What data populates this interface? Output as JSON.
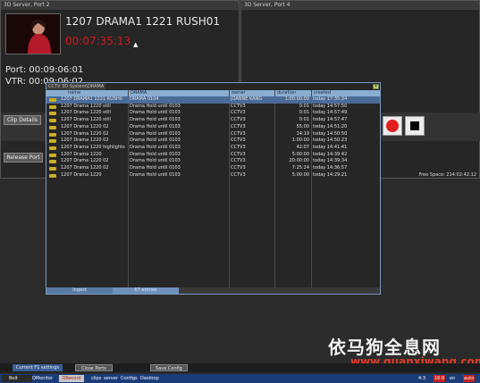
{
  "port_left": {
    "title": "3D Server, Port 2",
    "clip_name": "1207 DRAMA1 1221 RUSH01",
    "timecode": "00:07:35:13",
    "port_line": "Port: 00:09:06:01",
    "vtr_line": "VTR: 00:09:06:02",
    "buttons": {
      "clip_details": "Clip Details",
      "release_port": "Release Port"
    }
  },
  "port_right": {
    "title": "3D Server, Port 4",
    "free_space": "Free Space: 214:02:42:12"
  },
  "browser": {
    "title": "CCTV 3D System\\DRAMA",
    "columns": [
      "name",
      "DRAMA",
      "owner",
      "duration",
      "created"
    ],
    "rows": [
      {
        "name": "1207 DRAMA1 1221 RUSH0",
        "group": "DRAMA 0104",
        "owner": "JOANNE KANG",
        "duration": "1:00:00:00",
        "created": "today 17:35:34",
        "selected": true
      },
      {
        "name": "1207 Drama 1220 still",
        "group": "Drama Hold until 0103",
        "owner": "CCTV3",
        "duration": "0:01",
        "created": "today 14:57:50"
      },
      {
        "name": "1207 Drama 1220 still",
        "group": "Drama Hold until 0103",
        "owner": "CCTV3",
        "duration": "0:01",
        "created": "today 14:57:49"
      },
      {
        "name": "1207 Drama 1220 still",
        "group": "Drama Hold until 0103",
        "owner": "CCTV3",
        "duration": "0:01",
        "created": "today 14:57:47"
      },
      {
        "name": "1207 Drama 1220 02",
        "group": "Drama Hold until 0103",
        "owner": "CCTV3",
        "duration": "55:00",
        "created": "today 14:51:20"
      },
      {
        "name": "1207 Drama 1220 02",
        "group": "Drama Hold until 0103",
        "owner": "CCTV3",
        "duration": "14:19",
        "created": "today 14:50:50"
      },
      {
        "name": "1207 Drama 1220 02",
        "group": "Drama Hold until 0103",
        "owner": "CCTV3",
        "duration": "1:00:00",
        "created": "today 14:50:23"
      },
      {
        "name": "1207 Drama 1220 highlights",
        "group": "Drama Hold until 0103",
        "owner": "CCTV3",
        "duration": "42:07",
        "created": "today 14:41:41"
      },
      {
        "name": "1207 Drama 1220",
        "group": "Drama Hold until 0103",
        "owner": "CCTV3",
        "duration": "5:00:00",
        "created": "today 14:39:42"
      },
      {
        "name": "1207 Drama 1220 02",
        "group": "Drama Hold until 0103",
        "owner": "CCTV3",
        "duration": "20:00:00",
        "created": "today 14:39:34"
      },
      {
        "name": "1207 Drama 1220 02",
        "group": "Drama Hold until 0103",
        "owner": "CCTV3",
        "duration": "7:25:24",
        "created": "today 14:36:57"
      },
      {
        "name": "1207 Drama 1220",
        "group": "Drama Hold until 0103",
        "owner": "CCTV3",
        "duration": "5:00:00",
        "created": "today 14:29:21"
      }
    ],
    "footer": {
      "ingest": "Ingest",
      "entries": "67 entries"
    }
  },
  "bottom_buttons": {
    "current_f1": "Current F1 settings",
    "close_ports": "Close Ports",
    "save_config": "Save Config"
  },
  "taskbar": {
    "items": [
      "Bolt",
      "QMonitor",
      "QRecord",
      "clips",
      "server",
      "Configs",
      "Desktop"
    ],
    "right": [
      "4:3",
      "16:9",
      "en",
      "auto"
    ]
  },
  "watermark": {
    "cn": "依马狗全息网",
    "url": "www.quanxiwang.com"
  },
  "colors": {
    "accent_red": "#d01818",
    "selection": "#4a6b98",
    "header": "#8aaed2",
    "taskbar": "#1a3c78"
  }
}
